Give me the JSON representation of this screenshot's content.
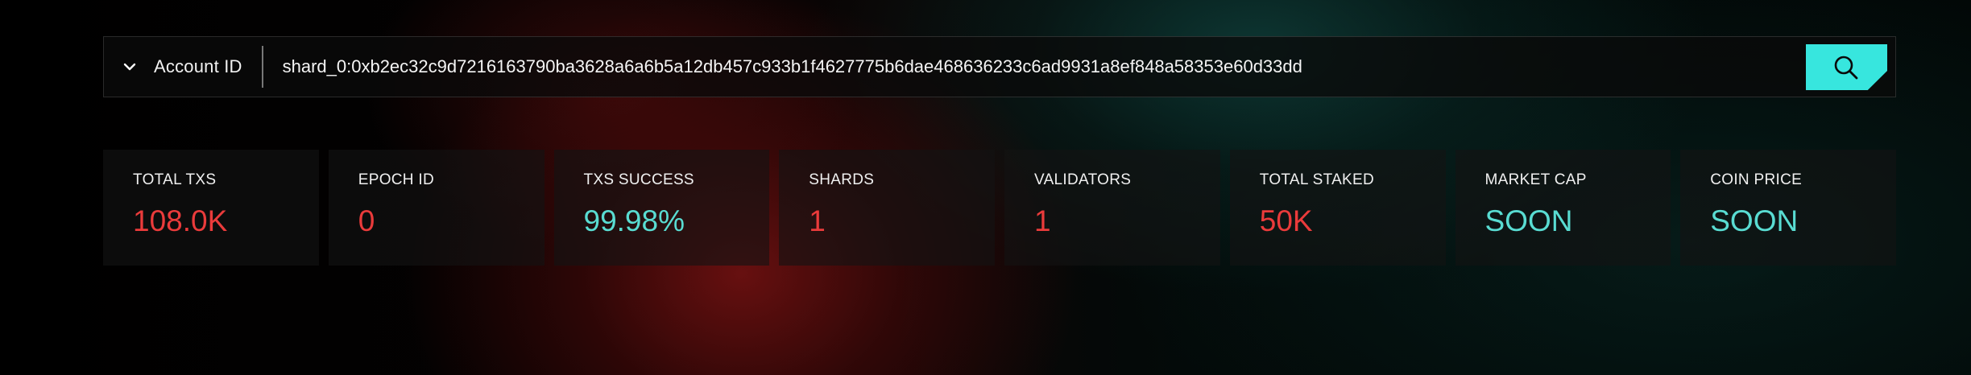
{
  "search": {
    "type_selector_label": "Account ID",
    "query_value": "shard_0:0xb2ec32c9d7216163790ba3628a6a6b5a12db457c933b1f4627775b6dae468636233c6ad9931a8ef848a58353e60d33dd",
    "button_icon": "search-icon",
    "button_color": "#37e6de"
  },
  "stats": [
    {
      "title": "TOTAL TXS",
      "value": "108.0K",
      "color": "#ea3b3b"
    },
    {
      "title": "EPOCH ID",
      "value": "0",
      "color": "#ea3b3b"
    },
    {
      "title": "TXS SUCCESS",
      "value": "99.98%",
      "color": "#59dcd2"
    },
    {
      "title": "SHARDS",
      "value": "1",
      "color": "#ea3b3b"
    },
    {
      "title": "VALIDATORS",
      "value": "1",
      "color": "#ea3b3b"
    },
    {
      "title": "TOTAL STAKED",
      "value": "50K",
      "color": "#ea3b3b"
    },
    {
      "title": "MARKET CAP",
      "value": "SOON",
      "color": "#59dcd2"
    },
    {
      "title": "COIN PRICE",
      "value": "SOON",
      "color": "#59dcd2"
    }
  ]
}
